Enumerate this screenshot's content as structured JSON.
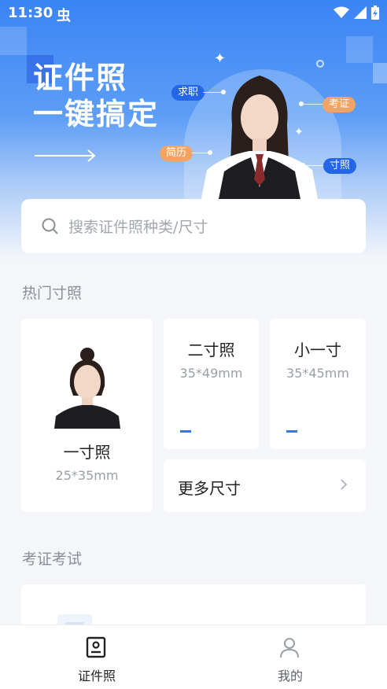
{
  "status_bar": {
    "time": "11:30",
    "notification_glyph": "虫"
  },
  "hero": {
    "title_line1": "证件照",
    "title_line2": "一键搞定",
    "tags": {
      "job": "求职",
      "exam": "考证",
      "resume": "简历",
      "photo": "寸照"
    }
  },
  "search": {
    "placeholder": "搜索证件照种类/尺寸"
  },
  "hot_section": {
    "title": "热门寸照",
    "one_inch": {
      "name": "一寸照",
      "size": "25*35mm"
    },
    "two_inch": {
      "name": "二寸照",
      "size": "35*49mm"
    },
    "small_one_inch": {
      "name": "小一寸",
      "size": "35*45mm"
    },
    "more": {
      "label": "更多尺寸"
    }
  },
  "exam_section": {
    "title": "考证考试"
  },
  "tabbar": {
    "tabs": [
      {
        "label": "证件照",
        "icon": "id-card-icon",
        "active": true
      },
      {
        "label": "我的",
        "icon": "person-icon",
        "active": false
      }
    ]
  },
  "colors": {
    "accent": "#2f7bef",
    "tag_blue": "#2466e8",
    "tag_orange": "#f1a463",
    "active_tab": "#222222",
    "inactive_tab": "#8a8e96"
  }
}
